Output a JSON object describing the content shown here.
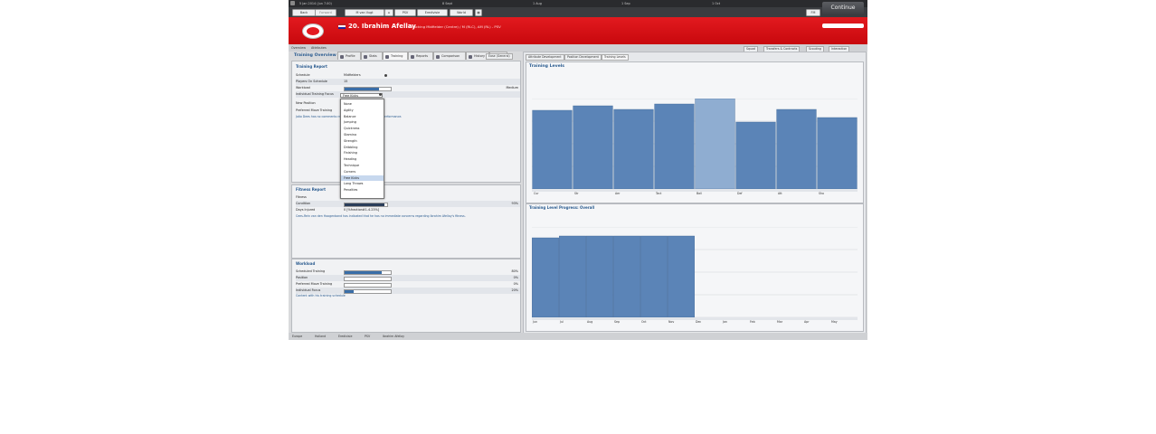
{
  "topbar": {
    "date": "5 Jan 2014 (Jun 7.00)",
    "club_short": "8 Sept",
    "slots": [
      "1 Aug",
      "1 Sep",
      "1 Oct"
    ],
    "continue": "Continue"
  },
  "nav": {
    "back": "Back",
    "forward": "Forward",
    "manager": "M van Vugt",
    "club": "PSV",
    "league": "Eredivisie",
    "world": "World",
    "lang": "FM"
  },
  "player": {
    "title": "20. Ibrahim Afellay",
    "desc": "Attacking Midfielder (Centre) / M (RLC), AM (RL) - PSV"
  },
  "tabs": [
    "Profile",
    "Stats",
    "Training",
    "Reports",
    "Comparison",
    "History",
    "Notes"
  ],
  "subnav": {
    "left": [
      "Overview",
      "Attributes"
    ],
    "right": [
      "Squad",
      "Transfers & Contracts",
      "Scouting",
      "Interaction"
    ]
  },
  "overview": {
    "title": "Training Overview",
    "dropdown": "Ease (General)"
  },
  "training_report": {
    "title": "Training Report",
    "rows": [
      {
        "label": "Schedule",
        "value": "Midfielders"
      },
      {
        "label": "Players On Schedule",
        "value": "15"
      },
      {
        "label": "Workload",
        "value": "Medium",
        "bar": 0.75
      },
      {
        "label": "Individual Training Focus",
        "value": "Free Kicks"
      },
      {
        "label": "New Position",
        "value": ""
      },
      {
        "label": "Preferred Move Training",
        "value": ""
      }
    ],
    "note": "João Dees has no comments regarding the player's training performance."
  },
  "focus_options": [
    "None",
    "Agility",
    "Balance",
    "Jumping",
    "Quickness",
    "Stamina",
    "Strength",
    "Dribbling",
    "Finishing",
    "Heading",
    "Technique",
    "Corners",
    "Free Kicks",
    "Long Throws",
    "Penalties"
  ],
  "focus_selected_index": 12,
  "fitness_report": {
    "title": "Fitness Report",
    "rows": [
      {
        "label": "Fitness",
        "value": ""
      },
      {
        "label": "Condition",
        "value": "93%",
        "bar": 0.93
      },
      {
        "label": "Days Injured",
        "value": "0 [%fraction#1-4.23%]"
      }
    ],
    "note": "Cees-Rein van den Hoogenband has indicated that he has no immediate concerns regarding Ibrahim Afellay's fitness."
  },
  "workload": {
    "title": "Workload",
    "rows": [
      {
        "label": "Scheduled Training",
        "pct": "80%",
        "bar": 0.8
      },
      {
        "label": "Position",
        "pct": "0%",
        "bar": 0
      },
      {
        "label": "Preferred Move Training",
        "pct": "0%",
        "bar": 0
      },
      {
        "label": "Individual Focus",
        "pct": "20%",
        "bar": 0.2
      }
    ],
    "note": "Content with his training schedule"
  },
  "right_tabs": [
    "Attribute Development",
    "Position Development",
    "Training Levels"
  ],
  "chart_data": [
    {
      "type": "bar",
      "title": "Training Levels",
      "categories": [
        "Cur",
        "Str",
        "Aer",
        "Tact",
        "Ball",
        "Def",
        "Att",
        "Sho"
      ],
      "values": [
        0.87,
        0.92,
        0.88,
        0.94,
        1.0,
        0.74,
        0.88,
        0.79
      ],
      "highlight_index": 4,
      "ylim": [
        0,
        1
      ],
      "grid": true,
      "colors": {
        "bar": "#5b84b7",
        "highlight": "#8fadd1"
      }
    },
    {
      "type": "bar",
      "title": "Training Level Progress: Overall",
      "categories": [
        "Jun",
        "Jul",
        "Aug",
        "Sep",
        "Oct",
        "Nov",
        "Dec",
        "Jan",
        "Feb",
        "Mar",
        "Apr",
        "May"
      ],
      "values": [
        0.88,
        0.9,
        0.9,
        0.9,
        0.9,
        0.9,
        null,
        null,
        null,
        null,
        null,
        null
      ],
      "ylim": [
        0,
        1
      ],
      "grid": true,
      "colors": {
        "bar": "#5b84b7"
      }
    }
  ],
  "bottom": [
    "Europe",
    "Holland",
    "Eredivisie",
    "PSV",
    "Ibrahim Afellay"
  ]
}
